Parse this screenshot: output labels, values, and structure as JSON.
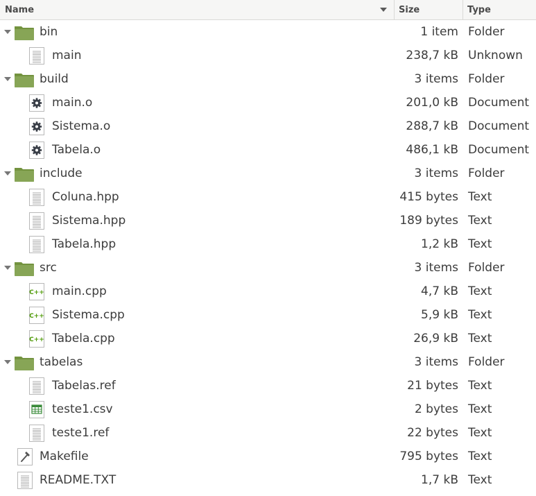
{
  "header": {
    "name": "Name",
    "size": "Size",
    "type": "Type"
  },
  "rows": [
    {
      "name": "bin",
      "size": "1 item",
      "type": "Folder",
      "icon": "folder",
      "depth": 0,
      "expander": true
    },
    {
      "name": "main",
      "size": "238,7 kB",
      "type": "Unknown",
      "icon": "text",
      "depth": 1,
      "expander": false
    },
    {
      "name": "build",
      "size": "3 items",
      "type": "Folder",
      "icon": "folder",
      "depth": 0,
      "expander": true
    },
    {
      "name": "main.o",
      "size": "201,0 kB",
      "type": "Document",
      "icon": "gear",
      "depth": 1,
      "expander": false
    },
    {
      "name": "Sistema.o",
      "size": "288,7 kB",
      "type": "Document",
      "icon": "gear",
      "depth": 1,
      "expander": false
    },
    {
      "name": "Tabela.o",
      "size": "486,1 kB",
      "type": "Document",
      "icon": "gear",
      "depth": 1,
      "expander": false
    },
    {
      "name": "include",
      "size": "3 items",
      "type": "Folder",
      "icon": "folder",
      "depth": 0,
      "expander": true
    },
    {
      "name": "Coluna.hpp",
      "size": "415 bytes",
      "type": "Text",
      "icon": "text",
      "depth": 1,
      "expander": false
    },
    {
      "name": "Sistema.hpp",
      "size": "189 bytes",
      "type": "Text",
      "icon": "text",
      "depth": 1,
      "expander": false
    },
    {
      "name": "Tabela.hpp",
      "size": "1,2 kB",
      "type": "Text",
      "icon": "text",
      "depth": 1,
      "expander": false
    },
    {
      "name": "src",
      "size": "3 items",
      "type": "Folder",
      "icon": "folder",
      "depth": 0,
      "expander": true
    },
    {
      "name": "main.cpp",
      "size": "4,7 kB",
      "type": "Text",
      "icon": "cpp",
      "depth": 1,
      "expander": false
    },
    {
      "name": "Sistema.cpp",
      "size": "5,9 kB",
      "type": "Text",
      "icon": "cpp",
      "depth": 1,
      "expander": false
    },
    {
      "name": "Tabela.cpp",
      "size": "26,9 kB",
      "type": "Text",
      "icon": "cpp",
      "depth": 1,
      "expander": false
    },
    {
      "name": "tabelas",
      "size": "3 items",
      "type": "Folder",
      "icon": "folder",
      "depth": 0,
      "expander": true
    },
    {
      "name": "Tabelas.ref",
      "size": "21 bytes",
      "type": "Text",
      "icon": "text",
      "depth": 1,
      "expander": false
    },
    {
      "name": "teste1.csv",
      "size": "2 bytes",
      "type": "Text",
      "icon": "spreadsheet",
      "depth": 1,
      "expander": false
    },
    {
      "name": "teste1.ref",
      "size": "22 bytes",
      "type": "Text",
      "icon": "text",
      "depth": 1,
      "expander": false
    },
    {
      "name": "Makefile",
      "size": "795 bytes",
      "type": "Text",
      "icon": "makefile",
      "depth": 0,
      "expander": false
    },
    {
      "name": "README.TXT",
      "size": "1,7 kB",
      "type": "Text",
      "icon": "text",
      "depth": 0,
      "expander": false
    }
  ],
  "icon_names": {
    "folder": "folder-icon",
    "text": "text-file-icon",
    "gear": "gear-file-icon",
    "cpp": "cpp-file-icon",
    "spreadsheet": "spreadsheet-file-icon",
    "makefile": "makefile-icon"
  },
  "colors": {
    "folder": "#87a556",
    "cpp": "#4e9a06",
    "spreadsheet": "#3a8a3a",
    "gear": "#3a3f48"
  }
}
